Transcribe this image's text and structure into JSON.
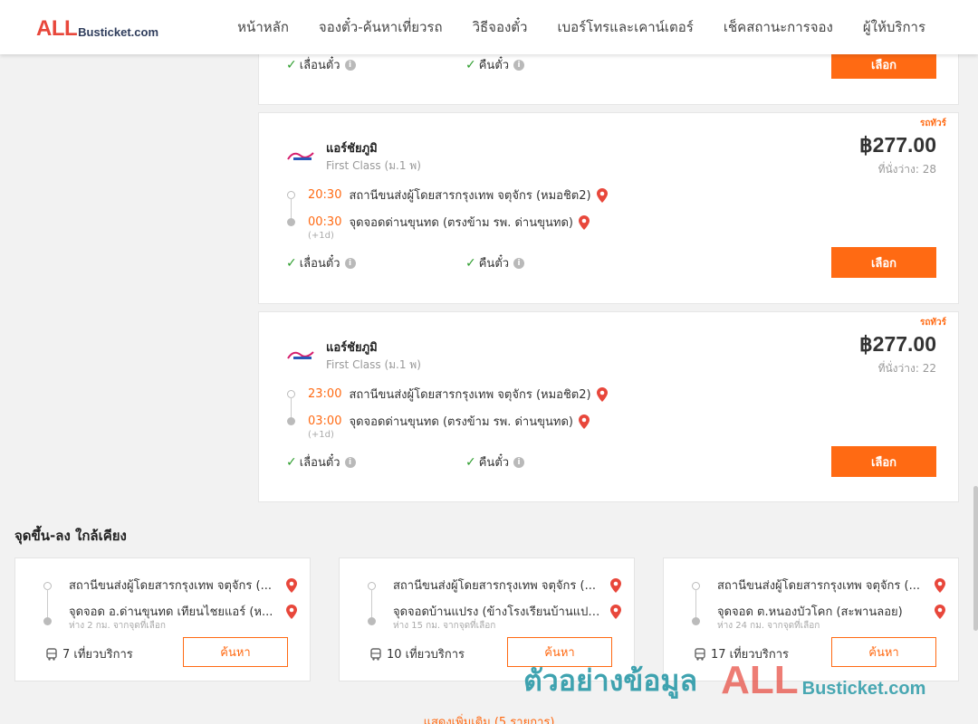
{
  "brand": {
    "logo_big": "ALL",
    "logo_small": "Busticket.com"
  },
  "nav": [
    "หน้าหลัก",
    "จองตั๋ว-ค้นหาเที่ยวรถ",
    "วิธีจองตั๋ว",
    "เบอร์โทรและเคาน์เตอร์",
    "เช็คสถานะการจอง",
    "ผู้ให้บริการ"
  ],
  "top_card": {
    "move": "เลื่อนตั๋ว",
    "refund": "คืนตั๋ว",
    "select": "เลือก"
  },
  "trips": [
    {
      "badge": "รถทัวร์",
      "operator": "แอร์ชัยภูมิ",
      "class": "First Class (ม.1 พ)",
      "price": "฿277.00",
      "seats": "ที่นั่งว่าง: 28",
      "dep_time": "20:30",
      "dep_place": "สถานีขนส่งผู้โดยสารกรุงเทพ จตุจักร (หมอชิต2)",
      "arr_time": "00:30",
      "arr_place": "จุดจอดด่านขุนทด (ตรงข้าม รพ. ด่านขุนทด)",
      "next_day": "(+1d)",
      "move": "เลื่อนตั๋ว",
      "refund": "คืนตั๋ว",
      "select": "เลือก"
    },
    {
      "badge": "รถทัวร์",
      "operator": "แอร์ชัยภูมิ",
      "class": "First Class (ม.1 พ)",
      "price": "฿277.00",
      "seats": "ที่นั่งว่าง: 22",
      "dep_time": "23:00",
      "dep_place": "สถานีขนส่งผู้โดยสารกรุงเทพ จตุจักร (หมอชิต2)",
      "arr_time": "03:00",
      "arr_place": "จุดจอดด่านขุนทด (ตรงข้าม รพ. ด่านขุนทด)",
      "next_day": "(+1d)",
      "move": "เลื่อนตั๋ว",
      "refund": "คืนตั๋ว",
      "select": "เลือก"
    }
  ],
  "nearby": {
    "title": "จุดขึ้น-ลง ใกล้เคียง",
    "items": [
      {
        "from": "สถานีขนส่งผู้โดยสารกรุงเทพ จตุจักร (...",
        "to": "จุดจอด อ.ด่านขุนทด เทียนไชยแอร์ (ห...",
        "distance": "ห่าง 2 กม. จากจุดที่เลือก",
        "trips": "7 เที่ยวบริการ",
        "search": "ค้นหา"
      },
      {
        "from": "สถานีขนส่งผู้โดยสารกรุงเทพ จตุจักร (...",
        "to": "จุดจอดบ้านแปรง (ข้างโรงเรียนบ้านแปร...",
        "distance": "ห่าง 15 กม. จากจุดที่เลือก",
        "trips": "10 เที่ยวบริการ",
        "search": "ค้นหา"
      },
      {
        "from": "สถานีขนส่งผู้โดยสารกรุงเทพ จตุจักร (...",
        "to": "จุดจอด ต.หนองบัวโคก (สะพานลอย)",
        "distance": "ห่าง 24 กม. จากจุดที่เลือก",
        "trips": "17 เที่ยวบริการ",
        "search": "ค้นหา"
      }
    ],
    "show_more": "แสดงเพิ่มเติม (5 รายการ)"
  },
  "watermark": {
    "text": "ตัวอย่างข้อมูล",
    "logo_big": "ALL",
    "logo_small": "Busticket.com"
  },
  "icons": {
    "pin": "map-pin-icon",
    "check": "check-icon",
    "info": "info-icon",
    "bus": "bus-icon"
  },
  "colors": {
    "accent": "#ff6a13",
    "brand_red": "#e8473b",
    "check_green": "#2e9d2e"
  }
}
